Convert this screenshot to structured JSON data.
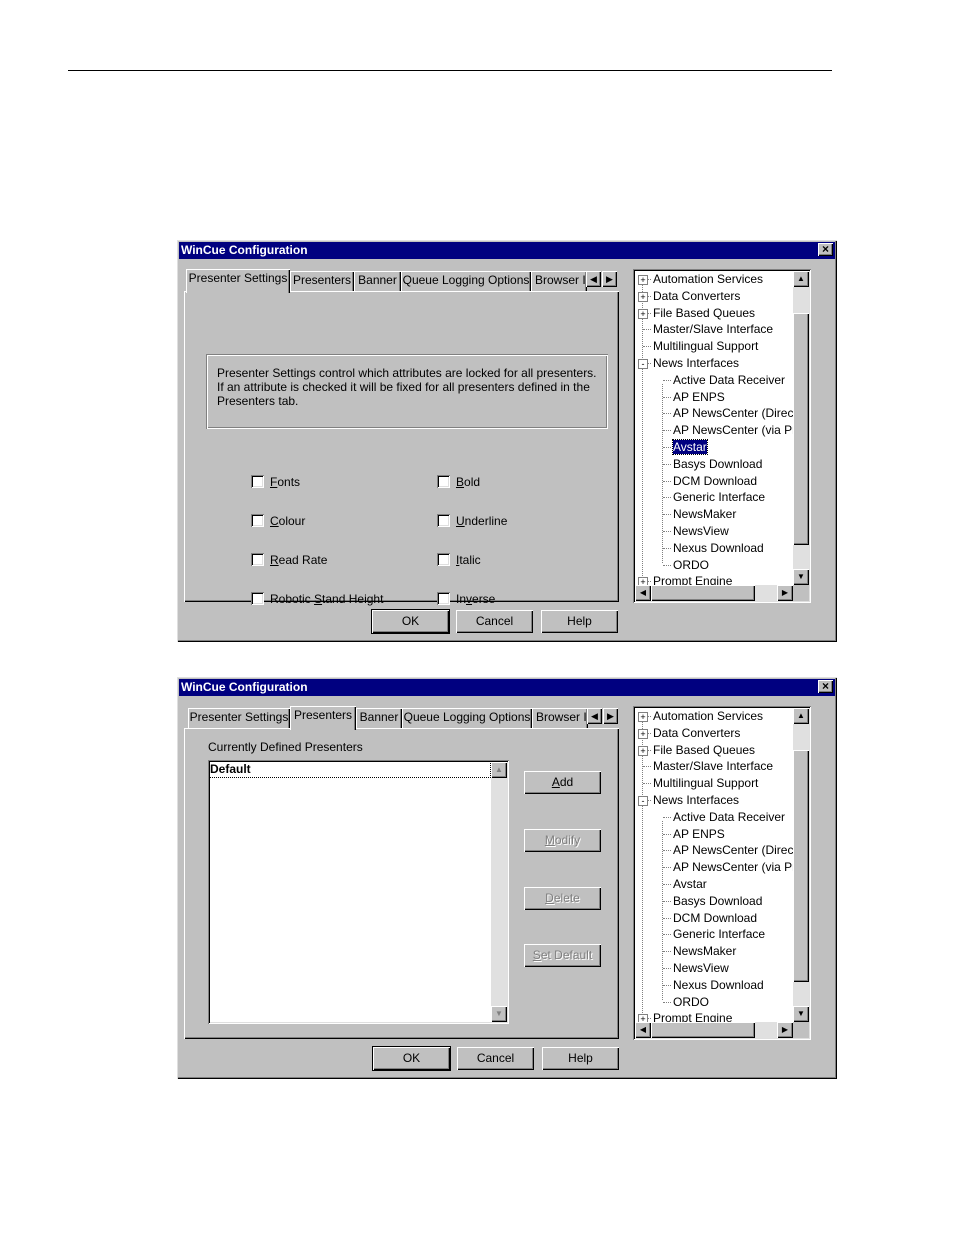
{
  "window1": {
    "title": "WinCue Configuration",
    "close_glyph": "×",
    "tabs": [
      "Presenter Settings",
      "Presenters",
      "Banner",
      "Queue Logging Options",
      "Browser I"
    ],
    "active_tab": "Presenter Settings",
    "description": "Presenter Settings control which attributes are locked for all presenters.  If an attribute is checked it will be fixed for all presenters defined in the Presenters tab.",
    "checkboxes": {
      "fonts": {
        "pre": "",
        "u": "F",
        "post": "onts",
        "checked": false
      },
      "colour": {
        "pre": "",
        "u": "C",
        "post": "olour",
        "checked": false
      },
      "read_rate": {
        "pre": "",
        "u": "R",
        "post": "ead Rate",
        "checked": false
      },
      "robotic": {
        "pre": "Robotic ",
        "u": "S",
        "post": "tand Height",
        "checked": false
      },
      "bold": {
        "pre": "",
        "u": "B",
        "post": "old",
        "checked": false
      },
      "underline": {
        "pre": "",
        "u": "U",
        "post": "nderline",
        "checked": false
      },
      "italic": {
        "pre": "",
        "u": "I",
        "post": "talic",
        "checked": false
      },
      "inverse": {
        "pre": "In",
        "u": "v",
        "post": "erse",
        "checked": false
      }
    },
    "buttons": {
      "ok": "OK",
      "cancel": "Cancel",
      "help": "Help"
    }
  },
  "window2": {
    "title": "WinCue Configuration",
    "close_glyph": "×",
    "tabs": [
      "Presenter Settings",
      "Presenters",
      "Banner",
      "Queue Logging Options",
      "Browser I"
    ],
    "active_tab": "Presenters",
    "list_label": "Currently Defined Presenters",
    "presenters": [
      "Default"
    ],
    "side_buttons": {
      "add": {
        "pre": "",
        "u": "A",
        "post": "dd"
      },
      "modify": {
        "pre": "",
        "u": "M",
        "post": "odify"
      },
      "delete": {
        "pre": "",
        "u": "D",
        "post": "elete"
      },
      "set_default": {
        "pre": "",
        "u": "S",
        "post": "et Default"
      }
    },
    "buttons": {
      "ok": "OK",
      "cancel": "Cancel",
      "help": "Help"
    }
  },
  "tree": {
    "items": [
      {
        "label": "Automation Services",
        "level": 0,
        "expander": "+"
      },
      {
        "label": "Data Converters",
        "level": 0,
        "expander": "+"
      },
      {
        "label": "File Based Queues",
        "level": 0,
        "expander": "+"
      },
      {
        "label": "Master/Slave Interface",
        "level": 0,
        "expander": ""
      },
      {
        "label": "Multilingual Support",
        "level": 0,
        "expander": ""
      },
      {
        "label": "News Interfaces",
        "level": 0,
        "expander": "-"
      },
      {
        "label": "Active Data Receiver",
        "level": 1,
        "expander": ""
      },
      {
        "label": "AP ENPS",
        "level": 1,
        "expander": ""
      },
      {
        "label": "AP NewsCenter (Direct)",
        "level": 1,
        "expander": ""
      },
      {
        "label": "AP NewsCenter (via Pro",
        "level": 1,
        "expander": ""
      },
      {
        "label": "Avstar",
        "level": 1,
        "expander": ""
      },
      {
        "label": "Basys Download",
        "level": 1,
        "expander": ""
      },
      {
        "label": "DCM Download",
        "level": 1,
        "expander": ""
      },
      {
        "label": "Generic Interface",
        "level": 1,
        "expander": ""
      },
      {
        "label": "NewsMaker",
        "level": 1,
        "expander": ""
      },
      {
        "label": "NewsView",
        "level": 1,
        "expander": ""
      },
      {
        "label": "Nexus Download",
        "level": 1,
        "expander": ""
      },
      {
        "label": "ORDO",
        "level": 1,
        "expander": ""
      },
      {
        "label": "Prompt Engine",
        "level": 0,
        "expander": "+"
      }
    ],
    "selected_in_window1": "Avstar"
  },
  "icons": {
    "scroll_up": "▲",
    "scroll_down": "▼",
    "scroll_left": "◀",
    "scroll_right": "▶"
  }
}
